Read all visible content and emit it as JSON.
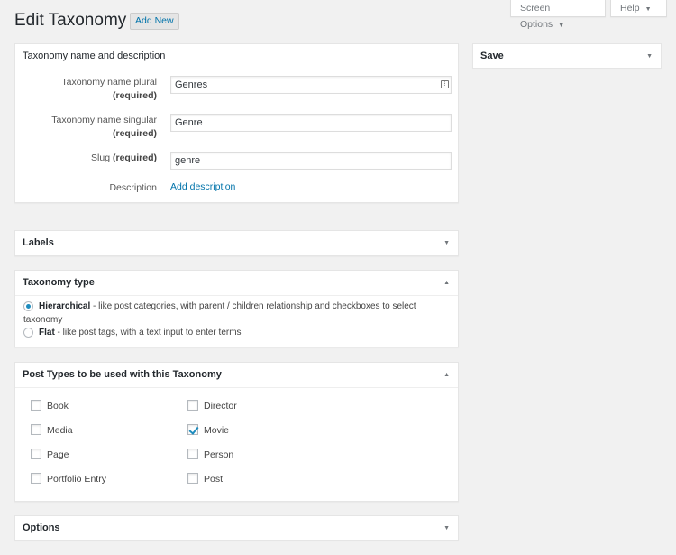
{
  "header": {
    "title": "Edit Taxonomy",
    "add_new": "Add New",
    "screen_options": "Screen Options",
    "help": "Help"
  },
  "name_box": {
    "title": "Taxonomy name and description",
    "plural_label": "Taxonomy name plural",
    "plural_value": "Genres",
    "singular_label": "Taxonomy name singular",
    "singular_value": "Genre",
    "slug_label": "Slug",
    "slug_value": "genre",
    "required": "(required)",
    "description_label": "Description",
    "add_description": "Add description"
  },
  "labels_box": {
    "title": "Labels"
  },
  "type_box": {
    "title": "Taxonomy type",
    "hierarchical_name": "Hierarchical",
    "hierarchical_desc": " - like post categories, with parent / children relationship and checkboxes to select taxonomy",
    "flat_name": "Flat",
    "flat_desc": " - like post tags, with a text input to enter terms",
    "selected": "hierarchical"
  },
  "post_types_box": {
    "title": "Post Types to be used with this Taxonomy",
    "items": [
      {
        "label": "Book",
        "checked": false
      },
      {
        "label": "Director",
        "checked": false
      },
      {
        "label": "Media",
        "checked": false
      },
      {
        "label": "Movie",
        "checked": true
      },
      {
        "label": "Page",
        "checked": false
      },
      {
        "label": "Person",
        "checked": false
      },
      {
        "label": "Portfolio Entry",
        "checked": false
      },
      {
        "label": "Post",
        "checked": false
      }
    ]
  },
  "options_box": {
    "title": "Options"
  },
  "save_box": {
    "title": "Save"
  },
  "colors": {
    "link": "#0073aa",
    "check": "#1e8cbe",
    "background": "#f1f1f1"
  }
}
